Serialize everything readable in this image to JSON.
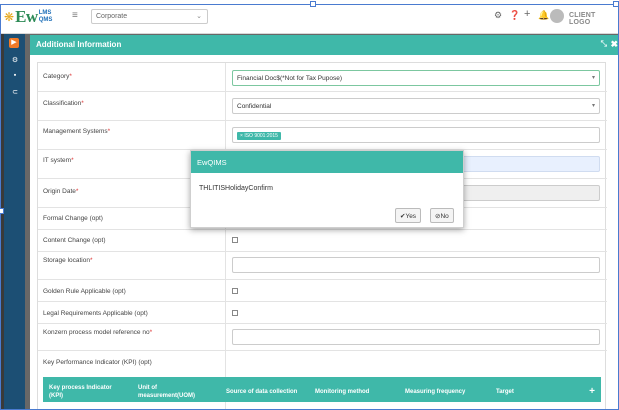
{
  "app": {
    "logo_text": "Ew",
    "logo_sup_top": "LMS",
    "logo_sup_bottom": "QMS",
    "org_select": "Corporate",
    "client_logo": "CLIENT LOGO"
  },
  "modal": {
    "title": "Additional Information",
    "fields": {
      "category_label": "Category",
      "category_value": "Financial Doc$(*Not for Tax Pupose)",
      "classification_label": "Classification",
      "classification_value": "Confidential",
      "management_label": "Management Systems",
      "management_tag": "ISO 9001:2015",
      "it_label": "IT system",
      "origin_label": "Origin Date",
      "formal_label": "Formal Change (opt)",
      "content_label": "Content Change (opt)",
      "storage_label": "Storage location",
      "golden_label": "Golden Rule Applicable (opt)",
      "legal_label": "Legal Requirements Applicable (opt)",
      "konzern_label": "Konzern process model reference no",
      "kpi_label": "Key Performance Indicator (KPI) (opt)"
    },
    "table_headers": {
      "kpi": "Key process Indicator (KPI)",
      "uom": "Unit of measurement(UOM)",
      "source": "Source of data collection",
      "method": "Monitoring method",
      "frequency": "Measuring frequency",
      "target": "Target",
      "add": "+"
    }
  },
  "dialog": {
    "title": "EwQIMS",
    "message": "THLITISHolidayConfirm",
    "yes": "Yes",
    "no": "No"
  },
  "colors": {
    "teal": "#3fb8a9",
    "navy": "#1c4f74",
    "orange": "#f07a28"
  },
  "icons": [
    "logo-flower-icon",
    "menu-icon",
    "gear-icon",
    "help-icon",
    "plus-icon",
    "bell-icon",
    "close-icon",
    "resize-icon",
    "check-icon",
    "ban-icon"
  ]
}
